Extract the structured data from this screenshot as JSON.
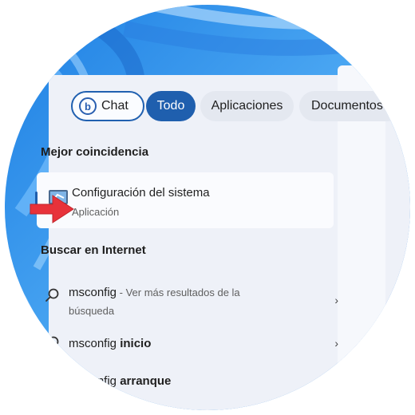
{
  "chips": {
    "chat": "Chat",
    "all": "Todo",
    "apps": "Aplicaciones",
    "docs": "Documentos"
  },
  "best_match": {
    "section_title": "Mejor coincidencia",
    "title": "Configuración del sistema",
    "subtitle": "Aplicación",
    "icon": "system-configuration-icon"
  },
  "web_search": {
    "section_title": "Buscar en Internet",
    "results": [
      {
        "query": "msconfig",
        "suffix": " - Ver más resultados de la",
        "suffix2": "búsqueda"
      },
      {
        "query": "msconfig",
        "bold": " inicio"
      },
      {
        "query": "msconfig",
        "bold": " arranque"
      }
    ]
  },
  "colors": {
    "accent": "#1f5fae",
    "arrow": "#e8323a",
    "wallpaper": "#2f8be8"
  }
}
